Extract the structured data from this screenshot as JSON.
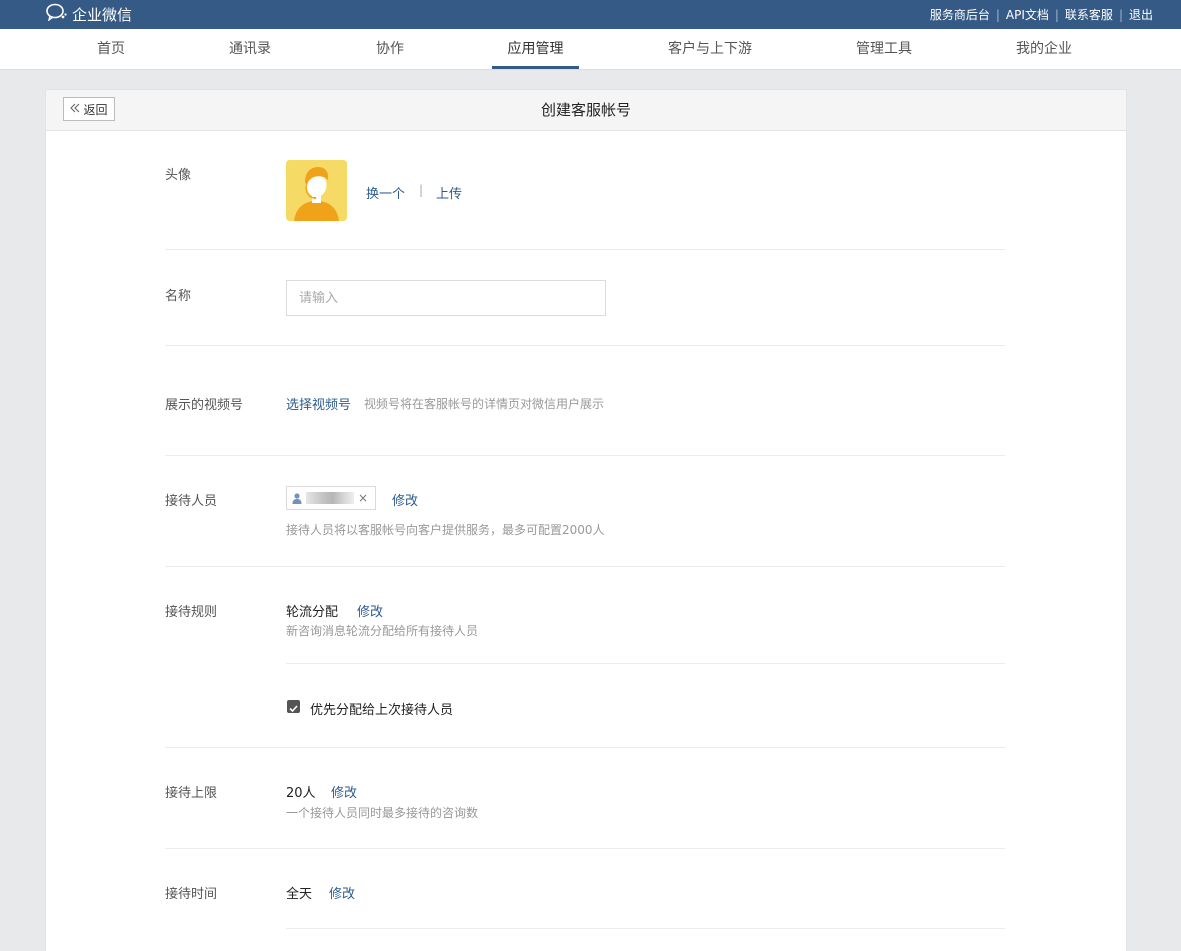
{
  "topbar": {
    "logo_text": "企业微信",
    "links": [
      "服务商后台",
      "API文档",
      "联系客服",
      "退出"
    ]
  },
  "nav": {
    "items": [
      "首页",
      "通讯录",
      "协作",
      "应用管理",
      "客户与上下游",
      "管理工具",
      "我的企业"
    ],
    "active": "应用管理"
  },
  "page": {
    "back_label": "返回",
    "title": "创建客服帐号"
  },
  "avatar_row": {
    "label": "头像",
    "change_link": "换一个",
    "sep": "|",
    "upload_link": "上传"
  },
  "name_row": {
    "label": "名称",
    "placeholder": "请输入",
    "value": ""
  },
  "video_row": {
    "label": "展示的视频号",
    "link": "选择视频号",
    "hint": "视频号将在客服帐号的详情页对微信用户展示"
  },
  "staff_row": {
    "label": "接待人员",
    "remove_symbol": "×",
    "modify_link": "修改",
    "hint": "接待人员将以客服帐号向客户提供服务，最多可配置2000人"
  },
  "rule_row": {
    "label": "接待规则",
    "value": "轮流分配",
    "modify_link": "修改",
    "hint": "新咨询消息轮流分配给所有接待人员",
    "checkbox_label": "优先分配给上次接待人员",
    "checkbox_checked": true
  },
  "limit_row": {
    "label": "接待上限",
    "value": "20人",
    "modify_link": "修改",
    "hint": "一个接待人员同时最多接待的咨询数"
  },
  "time_row": {
    "label": "接待时间",
    "value": "全天",
    "modify_link": "修改"
  },
  "colors": {
    "topbar": "#355a85",
    "link": "#2c5b8e",
    "page_bg": "#e8e9eb"
  }
}
